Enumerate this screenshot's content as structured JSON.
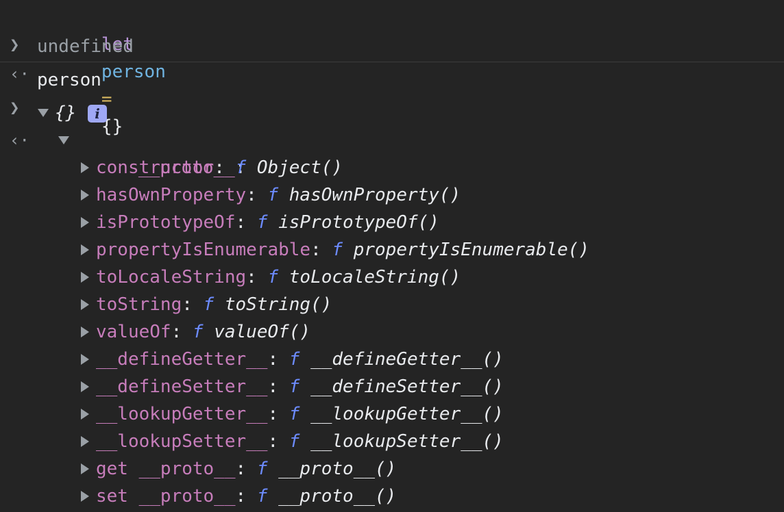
{
  "input_1": {
    "keyword": "let",
    "variable": "person",
    "operator": "=",
    "value": "{}"
  },
  "output_1": {
    "text": "undefined"
  },
  "input_2": {
    "text": "person"
  },
  "output_2": {
    "object_preview": "{}",
    "info_icon": "i",
    "proto_label": "__proto__",
    "colon": ":",
    "function_marker": "f",
    "properties": [
      {
        "name": "constructor",
        "value": "Object()"
      },
      {
        "name": "hasOwnProperty",
        "value": "hasOwnProperty()"
      },
      {
        "name": "isPrototypeOf",
        "value": "isPrototypeOf()"
      },
      {
        "name": "propertyIsEnumerable",
        "value": "propertyIsEnumerable()"
      },
      {
        "name": "toLocaleString",
        "value": "toLocaleString()"
      },
      {
        "name": "toString",
        "value": "toString()"
      },
      {
        "name": "valueOf",
        "value": "valueOf()"
      },
      {
        "name": "__defineGetter__",
        "value": "__defineGetter__()"
      },
      {
        "name": "__defineSetter__",
        "value": "__defineSetter__()"
      },
      {
        "name": "__lookupGetter__",
        "value": "__lookupGetter__()"
      },
      {
        "name": "__lookupSetter__",
        "value": "__lookupSetter__()"
      },
      {
        "name": "get __proto__",
        "value": "__proto__()"
      },
      {
        "name": "set __proto__",
        "value": "__proto__()"
      }
    ]
  },
  "icons": {
    "input_prompt": "chevron-right-icon",
    "output_prompt": "return-arrow-icon",
    "expanded": "triangle-down-icon",
    "collapsed": "triangle-right-icon"
  },
  "colors": {
    "background": "#242424",
    "keyword": "#b793d6",
    "variable": "#6fb3e0",
    "property": "#c77dbb",
    "function": "#6d8cff"
  }
}
